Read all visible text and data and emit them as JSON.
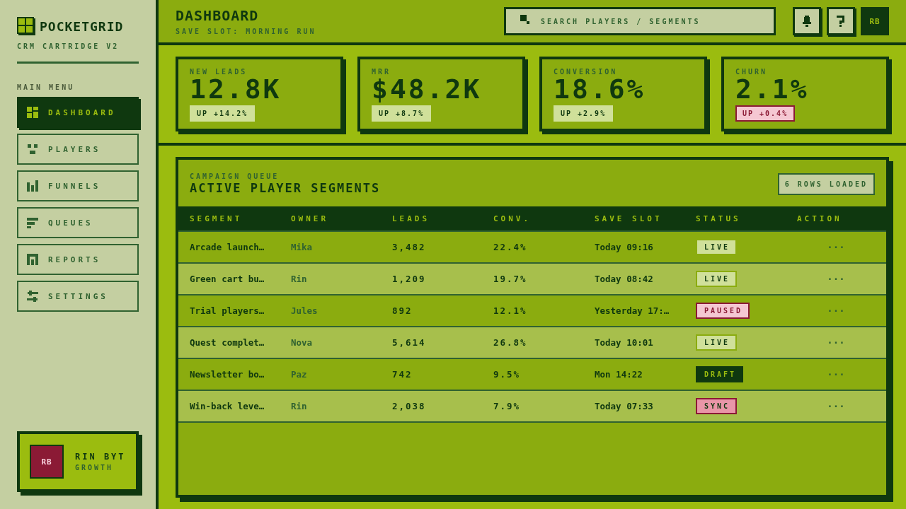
{
  "sidebar": {
    "brand": "POCKETGRID",
    "tagline": "CRM CARTRIDGE V2",
    "menu_title": "MAIN MENU",
    "items": [
      {
        "label": "DASHBOARD",
        "selected": true
      },
      {
        "label": "PLAYERS",
        "selected": false
      },
      {
        "label": "FUNNELS",
        "selected": false
      },
      {
        "label": "QUEUES",
        "selected": false
      },
      {
        "label": "REPORTS",
        "selected": false
      },
      {
        "label": "SETTINGS",
        "selected": false
      }
    ],
    "profile": {
      "initials": "RB",
      "name": "RIN BYT",
      "role": "GROWTH"
    }
  },
  "header": {
    "title": "DASHBOARD",
    "subtitle": "SAVE SLOT: MORNING RUN",
    "search": {
      "placeholder": "SEARCH PLAYERS / SEGMENTS"
    },
    "avatar": "RB"
  },
  "kpis": [
    {
      "label": "NEW LEADS",
      "value": "12.8K",
      "change": "UP +14.2%",
      "kind": "good"
    },
    {
      "label": "MRR",
      "value": "$48.2K",
      "change": "UP +8.7%",
      "kind": "good"
    },
    {
      "label": "CONVERSION",
      "value": "18.6%",
      "change": "UP +2.9%",
      "kind": "good"
    },
    {
      "label": "CHURN",
      "value": "2.1%",
      "change": "UP +0.4%",
      "kind": "bad"
    }
  ],
  "panel": {
    "eyebrow": "CAMPAIGN QUEUE",
    "title": "ACTIVE PLAYER SEGMENTS",
    "rows_loaded": "6 ROWS LOADED",
    "columns": [
      "SEGMENT",
      "OWNER",
      "LEADS",
      "CONV.",
      "SAVE SLOT",
      "STATUS",
      "ACTION"
    ],
    "rows": [
      {
        "segment": "Arcade launch…",
        "owner": "Mika",
        "leads": "3,482",
        "conv": "22.4%",
        "save_slot": "Today 09:16",
        "status": {
          "label": "LIVE",
          "kind": "live"
        },
        "action": "···"
      },
      {
        "segment": "Green cart bu…",
        "owner": "Rin",
        "leads": "1,209",
        "conv": "19.7%",
        "save_slot": "Today 08:42",
        "status": {
          "label": "LIVE",
          "kind": "live"
        },
        "action": "···"
      },
      {
        "segment": "Trial players…",
        "owner": "Jules",
        "leads": "892",
        "conv": "12.1%",
        "save_slot": "Yesterday 17:…",
        "status": {
          "label": "PAUSED",
          "kind": "paused"
        },
        "action": "···"
      },
      {
        "segment": "Quest complet…",
        "owner": "Nova",
        "leads": "5,614",
        "conv": "26.8%",
        "save_slot": "Today 10:01",
        "status": {
          "label": "LIVE",
          "kind": "live"
        },
        "action": "···"
      },
      {
        "segment": "Newsletter bo…",
        "owner": "Paz",
        "leads": "742",
        "conv": "9.5%",
        "save_slot": "Mon 14:22",
        "status": {
          "label": "DRAFT",
          "kind": "draft"
        },
        "action": "···"
      },
      {
        "segment": "Win-back leve…",
        "owner": "Rin",
        "leads": "2,038",
        "conv": "7.9%",
        "save_slot": "Today 07:33",
        "status": {
          "label": "SYNC",
          "kind": "sync"
        },
        "action": "···"
      }
    ]
  }
}
